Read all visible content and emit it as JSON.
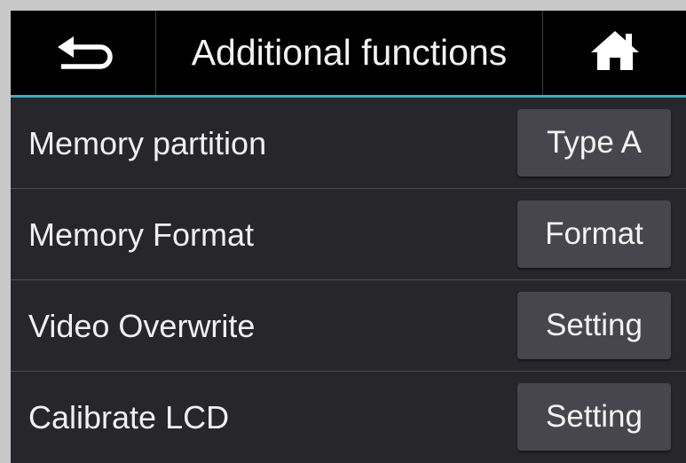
{
  "header": {
    "back_icon": "return-arrow-icon",
    "title": "Additional functions",
    "home_icon": "home-icon",
    "accent_color": "#2fb3c7"
  },
  "rows": [
    {
      "label": "Memory partition",
      "button": "Type A"
    },
    {
      "label": "Memory Format",
      "button": "Format"
    },
    {
      "label": "Video Overwrite",
      "button": "Setting"
    },
    {
      "label": "Calibrate LCD",
      "button": "Setting"
    }
  ]
}
